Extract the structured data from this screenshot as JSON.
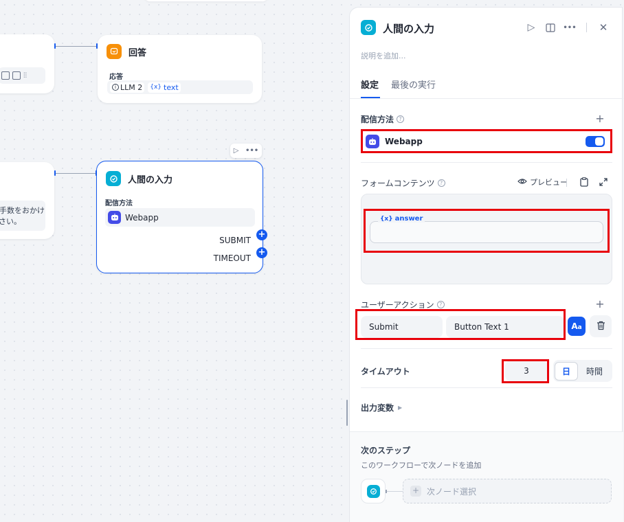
{
  "canvas": {
    "answer_node": {
      "title": "回答",
      "label": "応答",
      "llm_ref": "LLM 2",
      "var_ref": "text",
      "var_prefix": "{x}"
    },
    "prev_node_text_line1": "手数をおかけ",
    "prev_node_text_line2": "さい。",
    "human_node": {
      "title": "人間の入力",
      "label": "配信方法",
      "method": "Webapp",
      "out1": "SUBMIT",
      "out2": "TIMEOUT"
    }
  },
  "panel": {
    "title": "人間の入力",
    "description_placeholder": "説明を追加...",
    "tabs": [
      {
        "label": "設定",
        "active": true
      },
      {
        "label": "最後の実行",
        "active": false
      }
    ],
    "delivery": {
      "title": "配信方法",
      "method": "Webapp",
      "enabled": true
    },
    "form": {
      "title": "フォームコンテンツ",
      "preview_label": "プレビュー",
      "field_var": "answer",
      "field_prefix": "{x}"
    },
    "user_actions": {
      "title": "ユーザーアクション",
      "action_id": "Submit",
      "button_text": "Button Text 1"
    },
    "timeout": {
      "title": "タイムアウト",
      "value": "3",
      "units": [
        "日",
        "時間"
      ],
      "selected_unit": "日"
    },
    "output_vars": {
      "title": "出力変数"
    },
    "next_step": {
      "title": "次のステップ",
      "subtitle": "このワークフローで次ノードを追加",
      "select_label": "次ノード選択"
    }
  },
  "colors": {
    "accent": "#155aef",
    "node_icon_orange": "#f79009",
    "node_icon_cyan": "#06aed4",
    "webapp_purple": "#444ce7",
    "highlight_red": "#e8000b"
  }
}
